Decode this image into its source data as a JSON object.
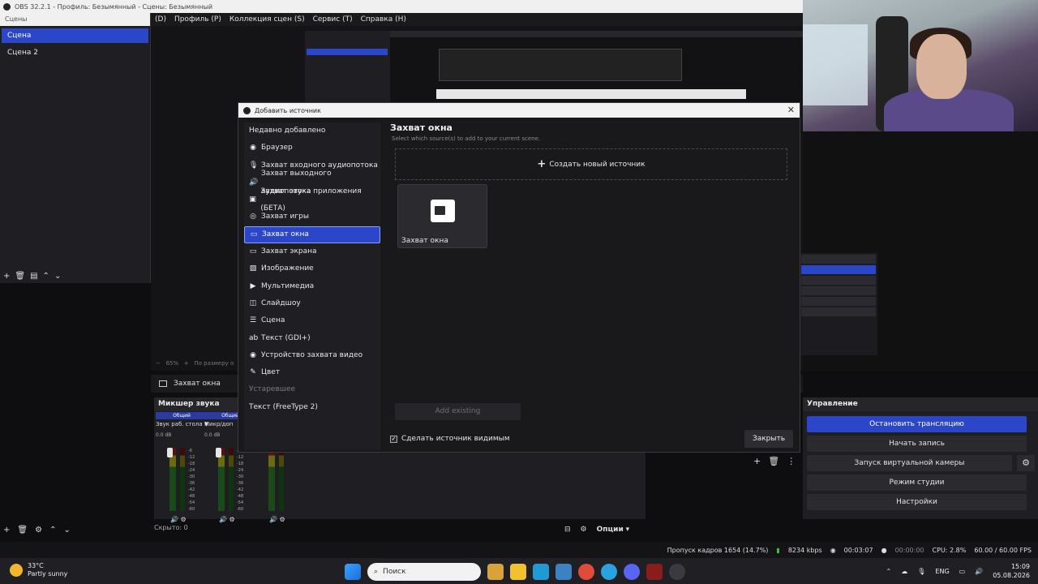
{
  "window": {
    "title": "OBS 32.2.1 - Профиль: Безымянный - Сцены: Безымянный"
  },
  "menu": [
    "(D)",
    "Профиль (P)",
    "Коллекция сцен (S)",
    "Сервис (T)",
    "Справка (H)"
  ],
  "scenes": {
    "title": "Сцены",
    "items": [
      "Сцена",
      "Сцена 2"
    ]
  },
  "preview": {
    "zoom": "65%",
    "fit_label": "По размеру о"
  },
  "source_bar": {
    "label": "Захват окна"
  },
  "mixer": {
    "title": "Микшер звука",
    "channels": [
      {
        "tag": "Общий",
        "name": "Звук раб. стола",
        "db": "0.0 dB"
      },
      {
        "tag": "Общий",
        "name": "Микр/доп",
        "db": "0.0 dB"
      },
      {
        "tag": "",
        "name": "",
        "db": ""
      }
    ],
    "scale": [
      "-6",
      "-12",
      "-18",
      "-24",
      "-30",
      "-36",
      "-42",
      "-48",
      "-54",
      "-60"
    ],
    "hidden": "Скрыто: 0",
    "options": "Опции"
  },
  "controls": {
    "title": "Управление",
    "stop_stream": "Остановить трансляцию",
    "start_record": "Начать запись",
    "virtual_cam": "Запуск виртуальной камеры",
    "studio_mode": "Режим студии",
    "settings": "Настройки"
  },
  "status": {
    "dropped": "Пропуск кадров 1654 (14.7%)",
    "bitrate": "8234 kbps",
    "stream_time": "00:03:07",
    "record_time": "00:00:00",
    "cpu": "CPU: 2.8%",
    "fps": "60.00 / 60.00 FPS"
  },
  "dialog": {
    "title": "Добавить источник",
    "recent": "Недавно добавлено",
    "sources": [
      {
        "label": "Браузер",
        "icon": "globe-icon",
        "glyph": "◉"
      },
      {
        "label": "Захват входного аудиопотока",
        "icon": "microphone-icon",
        "glyph": "🎙"
      },
      {
        "label": "Захват выходного аудиопотока",
        "icon": "speaker-icon",
        "glyph": "🔊"
      },
      {
        "label": "Захват звука приложения (БЕТА)",
        "icon": "app-audio-icon",
        "glyph": "▣"
      },
      {
        "label": "Захват игры",
        "icon": "gamepad-icon",
        "glyph": "◎"
      },
      {
        "label": "Захват окна",
        "icon": "window-icon",
        "glyph": "▭"
      },
      {
        "label": "Захват экрана",
        "icon": "monitor-icon",
        "glyph": "▭"
      },
      {
        "label": "Изображение",
        "icon": "image-icon",
        "glyph": "▨"
      },
      {
        "label": "Мультимедиа",
        "icon": "play-icon",
        "glyph": "▶"
      },
      {
        "label": "Слайдшоу",
        "icon": "slideshow-icon",
        "glyph": "◫"
      },
      {
        "label": "Сцена",
        "icon": "list-icon",
        "glyph": "☰"
      },
      {
        "label": "Текст (GDI+)",
        "icon": "text-icon",
        "glyph": "ab"
      },
      {
        "label": "Устройство захвата видео",
        "icon": "camera-icon",
        "glyph": "◉"
      },
      {
        "label": "Цвет",
        "icon": "brush-icon",
        "glyph": "✎"
      }
    ],
    "deprecated_header": "Устаревшее",
    "deprecated": [
      "Текст (FreeType 2)"
    ],
    "selected": "Захват окна",
    "panel_title": "Захват окна",
    "panel_subtitle": "Select which source(s) to add to your current scene.",
    "create_new": "Создать новый источник",
    "tile_label": "Захват окна",
    "add_existing": "Add existing",
    "make_visible": "Сделать источник видимым",
    "close": "Закрыть"
  },
  "taskbar": {
    "temperature": "33°C",
    "weather": "Partly sunny",
    "search": "Поиск",
    "language": "ENG",
    "time": "15:09",
    "date": "05.08.2026"
  },
  "colors": {
    "accent": "#2b46c9",
    "dialog_bg": "#19191c",
    "app_bg": "#1f1f23"
  }
}
